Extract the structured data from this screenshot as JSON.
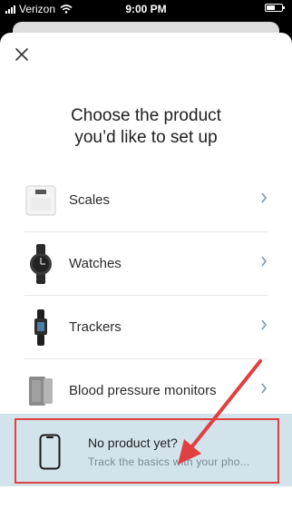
{
  "status_bar": {
    "carrier": "Verizon",
    "time": "9:00 PM"
  },
  "title_line1": "Choose the product",
  "title_line2": "you’d like to set up",
  "products": [
    {
      "label": "Scales",
      "icon": "scale-icon"
    },
    {
      "label": "Watches",
      "icon": "watch-icon"
    },
    {
      "label": "Trackers",
      "icon": "tracker-icon"
    },
    {
      "label": "Blood pressure monitors",
      "icon": "blood-pressure-monitor-icon"
    }
  ],
  "banner": {
    "title": "No product yet?",
    "subtitle": "Track the basics with your pho..."
  },
  "colors": {
    "accent_chevron": "#6e9bb4",
    "banner_bg": "#d3e3ec",
    "highlight": "#e04040"
  }
}
